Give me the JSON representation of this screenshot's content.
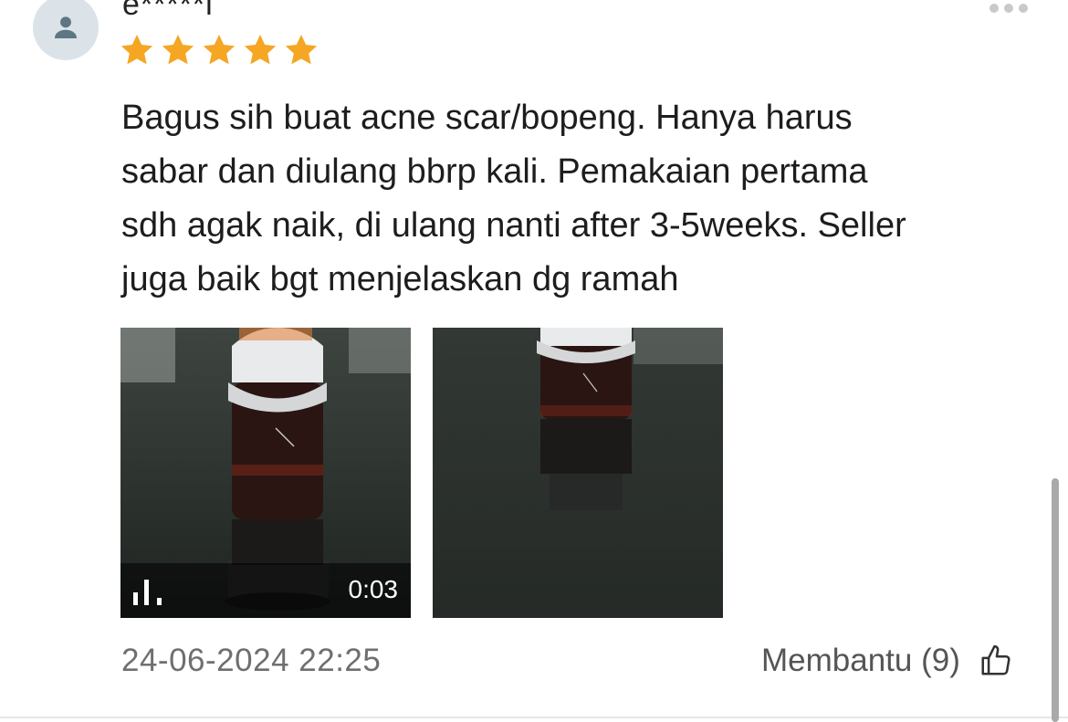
{
  "review": {
    "username": "e*****l",
    "rating": 5,
    "rating_max": 5,
    "text_lines": [
      "Bagus sih buat acne scar/bopeng. Hanya harus",
      "sabar dan diulang bbrp kali. Pemakaian pertama",
      "sdh agak naik, di ulang nanti after 3-5weeks. Seller",
      "juga baik bgt menjelaskan dg ramah"
    ],
    "video_duration": "0:03",
    "date": "24-06-2024 22:25",
    "helpful_label": "Membantu (9)"
  },
  "colors": {
    "star": "#f5a623",
    "avatar_bg": "#dbe3e8",
    "avatar_icon": "#5d7684"
  },
  "icons": {
    "avatar": "user-silhouette-icon",
    "more": "more-dots-icon",
    "video": "video-bars-icon",
    "helpful": "thumbs-up-icon"
  }
}
